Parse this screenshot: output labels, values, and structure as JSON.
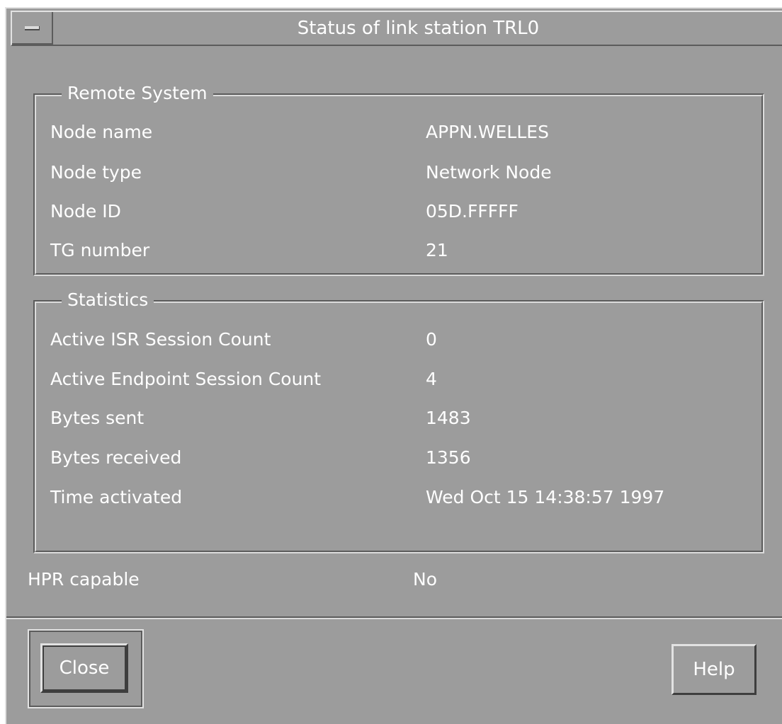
{
  "window": {
    "title": "Status of link station TRL0"
  },
  "remote_system": {
    "group_label": "Remote System",
    "rows": [
      {
        "label": "Node name",
        "value": "APPN.WELLES"
      },
      {
        "label": "Node type",
        "value": "Network Node"
      },
      {
        "label": "Node ID",
        "value": "05D.FFFFF"
      },
      {
        "label": "TG number",
        "value": "21"
      }
    ]
  },
  "statistics": {
    "group_label": "Statistics",
    "rows": [
      {
        "label": "Active ISR Session Count",
        "value": "0"
      },
      {
        "label": "Active Endpoint Session Count",
        "value": "4"
      },
      {
        "label": "Bytes sent",
        "value": "1483"
      },
      {
        "label": "Bytes received",
        "value": "1356"
      },
      {
        "label": "Time activated",
        "value": "Wed Oct 15 14:38:57 1997"
      }
    ]
  },
  "hpr": {
    "label": "HPR capable",
    "value": "No"
  },
  "buttons": {
    "close_label": "Close",
    "help_label": "Help"
  },
  "colors": {
    "background": "#9c9c9c",
    "text": "#ffffff",
    "highlight": "#e2e2e2",
    "shadow": "#5c5c5c"
  }
}
